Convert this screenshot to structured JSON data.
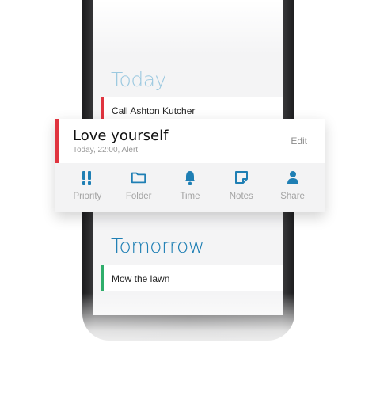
{
  "colors": {
    "accent_blue": "#1f7fb4",
    "today_header": "#9cc9e0",
    "priority_red": "#e0343f",
    "tomorrow_green": "#2fae6b"
  },
  "list": {
    "today_header": "Today",
    "today_items": [
      {
        "label": "Call Ashton Kutcher"
      }
    ],
    "tomorrow_header": "Tomorrow",
    "tomorrow_items": [
      {
        "label": "Mow the lawn"
      }
    ]
  },
  "popup": {
    "title": "Love yourself",
    "subtitle": "Today, 22:00, Alert",
    "edit_label": "Edit",
    "actions": [
      {
        "label": "Priority",
        "icon": "priority-icon"
      },
      {
        "label": "Folder",
        "icon": "folder-icon"
      },
      {
        "label": "Time",
        "icon": "bell-icon"
      },
      {
        "label": "Notes",
        "icon": "note-icon"
      },
      {
        "label": "Share",
        "icon": "person-icon"
      }
    ]
  }
}
